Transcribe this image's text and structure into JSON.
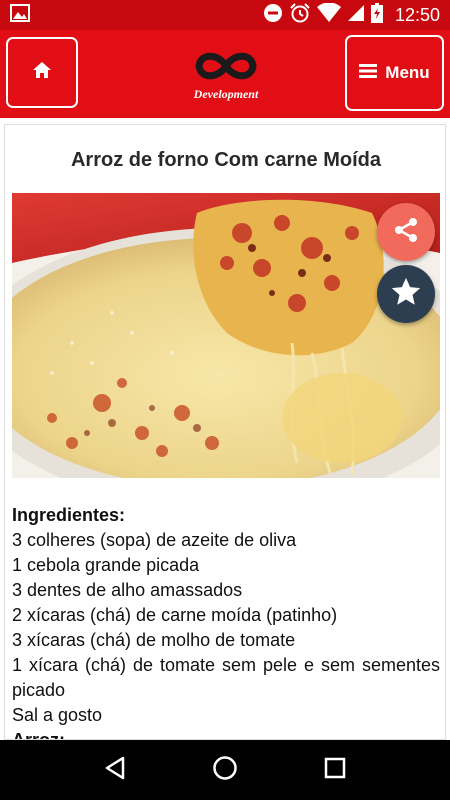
{
  "status_bar": {
    "time": "12:50",
    "icons": [
      "image-icon",
      "do-not-disturb-icon",
      "alarm-icon",
      "wifi-icon",
      "signal-icon",
      "battery-icon"
    ]
  },
  "header": {
    "logo_text": "Development",
    "menu_label": "Menu",
    "colors": {
      "bar": "#e20e16",
      "status": "#c8080f"
    }
  },
  "recipe": {
    "title": "Arroz de forno Com carne Moída",
    "ingredients_heading": "Ingredientes:",
    "ingredients": [
      "3 colheres (sopa) de azeite de oliva",
      "1 cebola grande picada",
      "3 dentes de alho amassados",
      "2 xícaras (chá) de carne moída (patinho)",
      "3 xícaras (chá) de molho de tomate",
      "1 xícara (chá) de tomate sem pele e sem sementes picado",
      "Sal a gosto"
    ],
    "rice_heading": "Arroz:"
  },
  "fabs": {
    "share_icon": "share-icon",
    "star_icon": "star-icon"
  },
  "nav": {
    "icons": [
      "back-icon",
      "home-circle-icon",
      "recents-icon"
    ]
  }
}
